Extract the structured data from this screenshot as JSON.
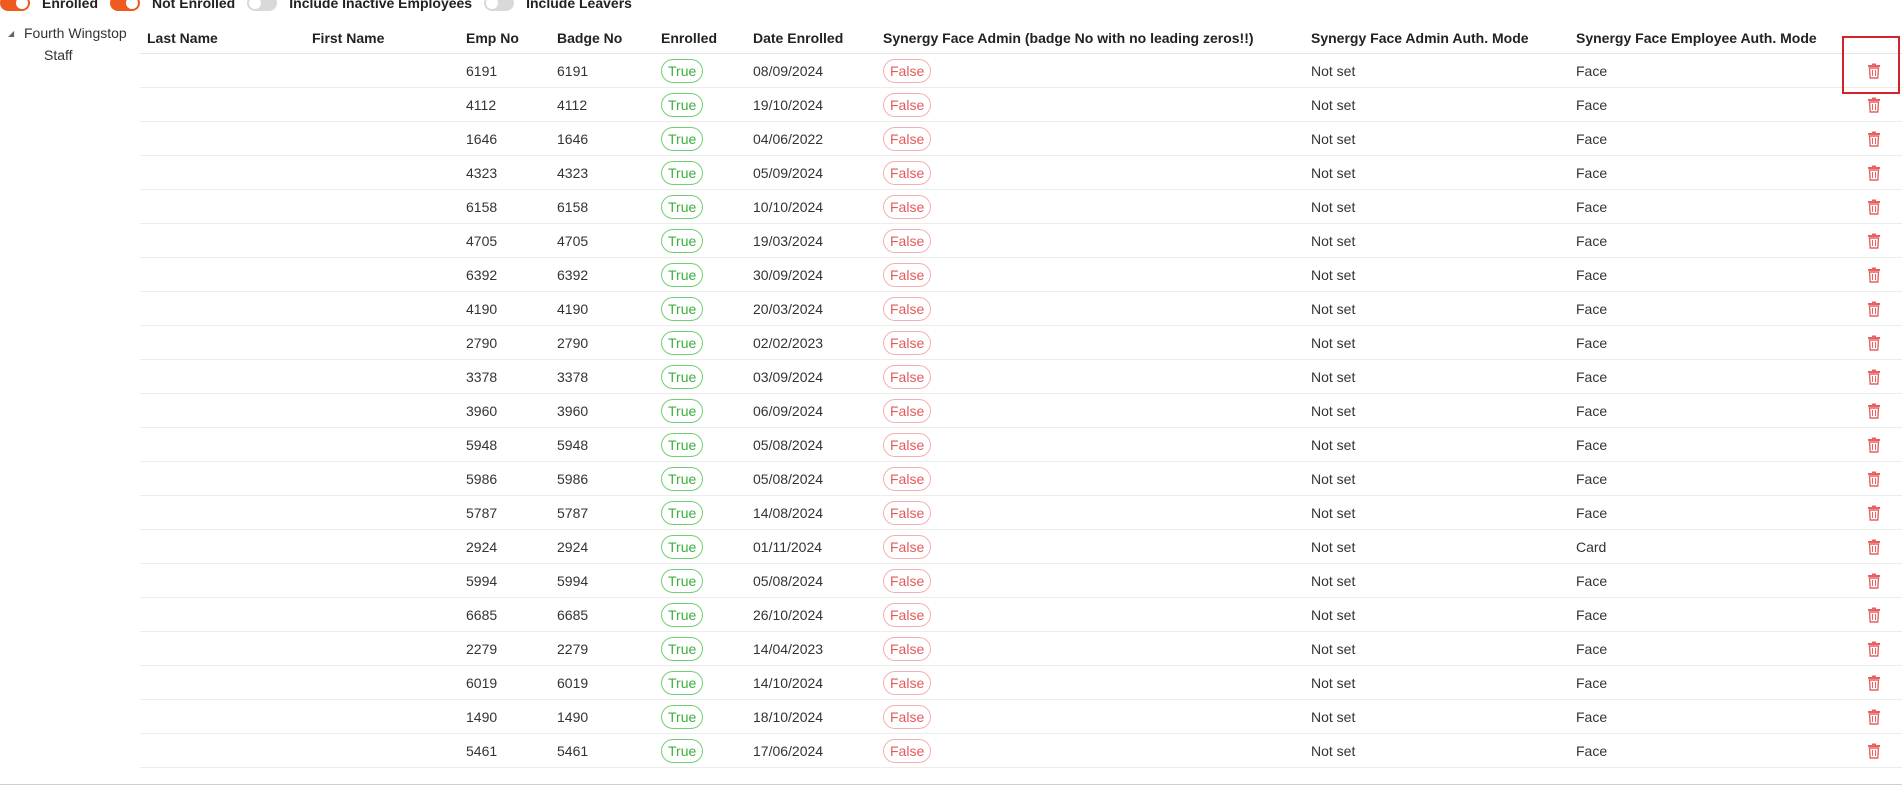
{
  "filters": [
    {
      "label": "Enrolled",
      "on": true
    },
    {
      "label": "Not Enrolled",
      "on": true
    },
    {
      "label": "Include Inactive Employees",
      "on": false
    },
    {
      "label": "Include Leavers",
      "on": false
    }
  ],
  "tree": {
    "root": "Fourth Wingstop",
    "child": "Staff"
  },
  "table": {
    "columns": [
      "Last Name",
      "First Name",
      "Emp No",
      "Badge No",
      "Enrolled",
      "Date Enrolled",
      "Synergy Face Admin (badge No with no leading zeros!!)",
      "Synergy Face Admin Auth. Mode",
      "Synergy Face Employee Auth. Mode",
      ""
    ],
    "rows": [
      {
        "last": "",
        "first": "",
        "emp": "6191",
        "badge": "6191",
        "enrolled": "True",
        "date": "08/09/2024",
        "admin": "False",
        "admin_mode": "Not set",
        "emp_mode": "Face"
      },
      {
        "last": "",
        "first": "",
        "emp": "4112",
        "badge": "4112",
        "enrolled": "True",
        "date": "19/10/2024",
        "admin": "False",
        "admin_mode": "Not set",
        "emp_mode": "Face"
      },
      {
        "last": "",
        "first": "",
        "emp": "1646",
        "badge": "1646",
        "enrolled": "True",
        "date": "04/06/2022",
        "admin": "False",
        "admin_mode": "Not set",
        "emp_mode": "Face"
      },
      {
        "last": "",
        "first": "",
        "emp": "4323",
        "badge": "4323",
        "enrolled": "True",
        "date": "05/09/2024",
        "admin": "False",
        "admin_mode": "Not set",
        "emp_mode": "Face"
      },
      {
        "last": "",
        "first": "",
        "emp": "6158",
        "badge": "6158",
        "enrolled": "True",
        "date": "10/10/2024",
        "admin": "False",
        "admin_mode": "Not set",
        "emp_mode": "Face"
      },
      {
        "last": "",
        "first": "",
        "emp": "4705",
        "badge": "4705",
        "enrolled": "True",
        "date": "19/03/2024",
        "admin": "False",
        "admin_mode": "Not set",
        "emp_mode": "Face"
      },
      {
        "last": "",
        "first": "",
        "emp": "6392",
        "badge": "6392",
        "enrolled": "True",
        "date": "30/09/2024",
        "admin": "False",
        "admin_mode": "Not set",
        "emp_mode": "Face"
      },
      {
        "last": "",
        "first": "",
        "emp": "4190",
        "badge": "4190",
        "enrolled": "True",
        "date": "20/03/2024",
        "admin": "False",
        "admin_mode": "Not set",
        "emp_mode": "Face"
      },
      {
        "last": "",
        "first": "",
        "emp": "2790",
        "badge": "2790",
        "enrolled": "True",
        "date": "02/02/2023",
        "admin": "False",
        "admin_mode": "Not set",
        "emp_mode": "Face"
      },
      {
        "last": "",
        "first": "",
        "emp": "3378",
        "badge": "3378",
        "enrolled": "True",
        "date": "03/09/2024",
        "admin": "False",
        "admin_mode": "Not set",
        "emp_mode": "Face"
      },
      {
        "last": "",
        "first": "",
        "emp": "3960",
        "badge": "3960",
        "enrolled": "True",
        "date": "06/09/2024",
        "admin": "False",
        "admin_mode": "Not set",
        "emp_mode": "Face"
      },
      {
        "last": "",
        "first": "",
        "emp": "5948",
        "badge": "5948",
        "enrolled": "True",
        "date": "05/08/2024",
        "admin": "False",
        "admin_mode": "Not set",
        "emp_mode": "Face"
      },
      {
        "last": "",
        "first": "",
        "emp": "5986",
        "badge": "5986",
        "enrolled": "True",
        "date": "05/08/2024",
        "admin": "False",
        "admin_mode": "Not set",
        "emp_mode": "Face"
      },
      {
        "last": "",
        "first": "",
        "emp": "5787",
        "badge": "5787",
        "enrolled": "True",
        "date": "14/08/2024",
        "admin": "False",
        "admin_mode": "Not set",
        "emp_mode": "Face"
      },
      {
        "last": "",
        "first": "",
        "emp": "2924",
        "badge": "2924",
        "enrolled": "True",
        "date": "01/11/2024",
        "admin": "False",
        "admin_mode": "Not set",
        "emp_mode": "Card"
      },
      {
        "last": "",
        "first": "",
        "emp": "5994",
        "badge": "5994",
        "enrolled": "True",
        "date": "05/08/2024",
        "admin": "False",
        "admin_mode": "Not set",
        "emp_mode": "Face"
      },
      {
        "last": "",
        "first": "",
        "emp": "6685",
        "badge": "6685",
        "enrolled": "True",
        "date": "26/10/2024",
        "admin": "False",
        "admin_mode": "Not set",
        "emp_mode": "Face"
      },
      {
        "last": "",
        "first": "",
        "emp": "2279",
        "badge": "2279",
        "enrolled": "True",
        "date": "14/04/2023",
        "admin": "False",
        "admin_mode": "Not set",
        "emp_mode": "Face"
      },
      {
        "last": "",
        "first": "",
        "emp": "6019",
        "badge": "6019",
        "enrolled": "True",
        "date": "14/10/2024",
        "admin": "False",
        "admin_mode": "Not set",
        "emp_mode": "Face"
      },
      {
        "last": "",
        "first": "",
        "emp": "1490",
        "badge": "1490",
        "enrolled": "True",
        "date": "18/10/2024",
        "admin": "False",
        "admin_mode": "Not set",
        "emp_mode": "Face"
      },
      {
        "last": "",
        "first": "",
        "emp": "5461",
        "badge": "5461",
        "enrolled": "True",
        "date": "17/06/2024",
        "admin": "False",
        "admin_mode": "Not set",
        "emp_mode": "Face"
      }
    ]
  },
  "colors": {
    "accent": "#ef5a1e",
    "true_green": "#3bb23b",
    "false_red": "#e45a5a",
    "trash": "#e86060",
    "highlight": "#d6202a"
  },
  "icons": {
    "delete": "trash-icon",
    "tree_expand": "caret-icon"
  }
}
